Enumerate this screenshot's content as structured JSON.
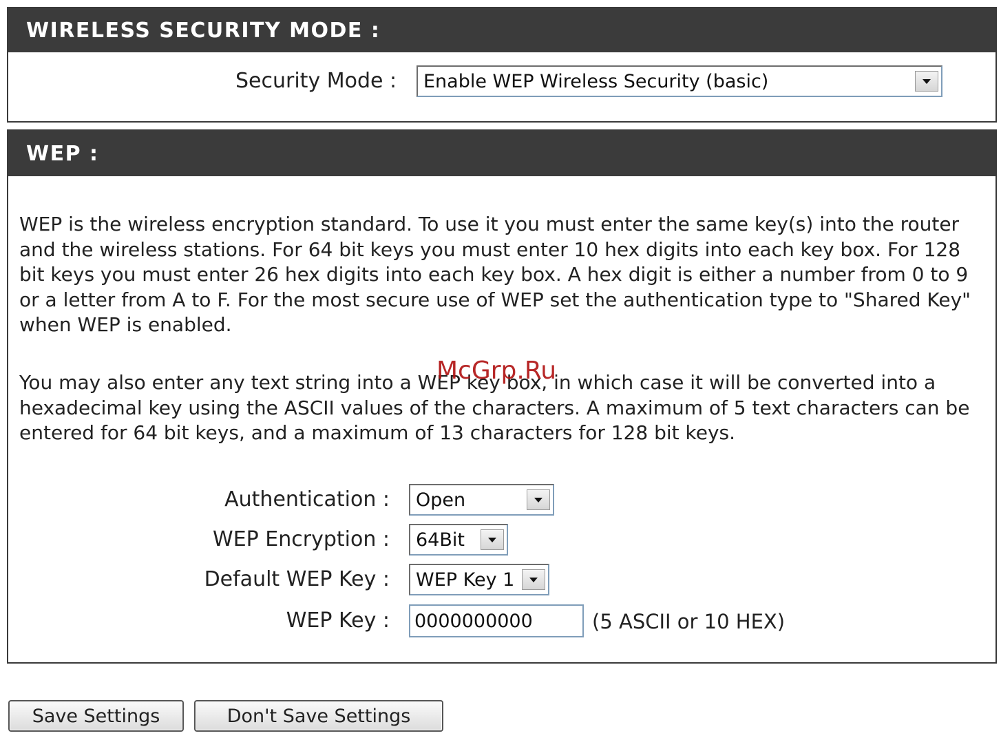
{
  "wireless_security_mode": {
    "title": "WIRELESS SECURITY MODE :",
    "security_mode_label": "Security Mode :",
    "security_mode_value": "Enable WEP Wireless Security (basic)"
  },
  "wep": {
    "title": "WEP :",
    "paragraph1": "WEP is the wireless encryption standard. To use it you must enter the same key(s) into the router and the wireless stations. For 64 bit keys you must enter 10 hex digits into each key box. For 128 bit keys you must enter 26 hex digits into each key box. A hex digit is either a number from 0 to 9 or a letter from A to F. For the most secure use of WEP set the authentication type to \"Shared Key\" when WEP is enabled.",
    "paragraph2": "You may also enter any text string into a WEP key box, in which case it will be converted into a hexadecimal key using the ASCII values of the characters. A maximum of 5 text characters can be entered for 64 bit keys, and a maximum of 13 characters for 128 bit keys.",
    "authentication_label": "Authentication :",
    "authentication_value": "Open",
    "encryption_label": "WEP Encryption :",
    "encryption_value": "64Bit",
    "default_key_label": "Default WEP Key :",
    "default_key_value": "WEP Key 1",
    "key_label": "WEP Key :",
    "key_value": "0000000000",
    "key_hint": "(5 ASCII or 10 HEX)"
  },
  "buttons": {
    "save": "Save Settings",
    "dont_save": "Don't Save Settings"
  },
  "watermark": "McGrp.Ru",
  "colors": {
    "header_bg": "#3b3b3b",
    "header_text": "#ffffff",
    "watermark": "#b01010"
  }
}
